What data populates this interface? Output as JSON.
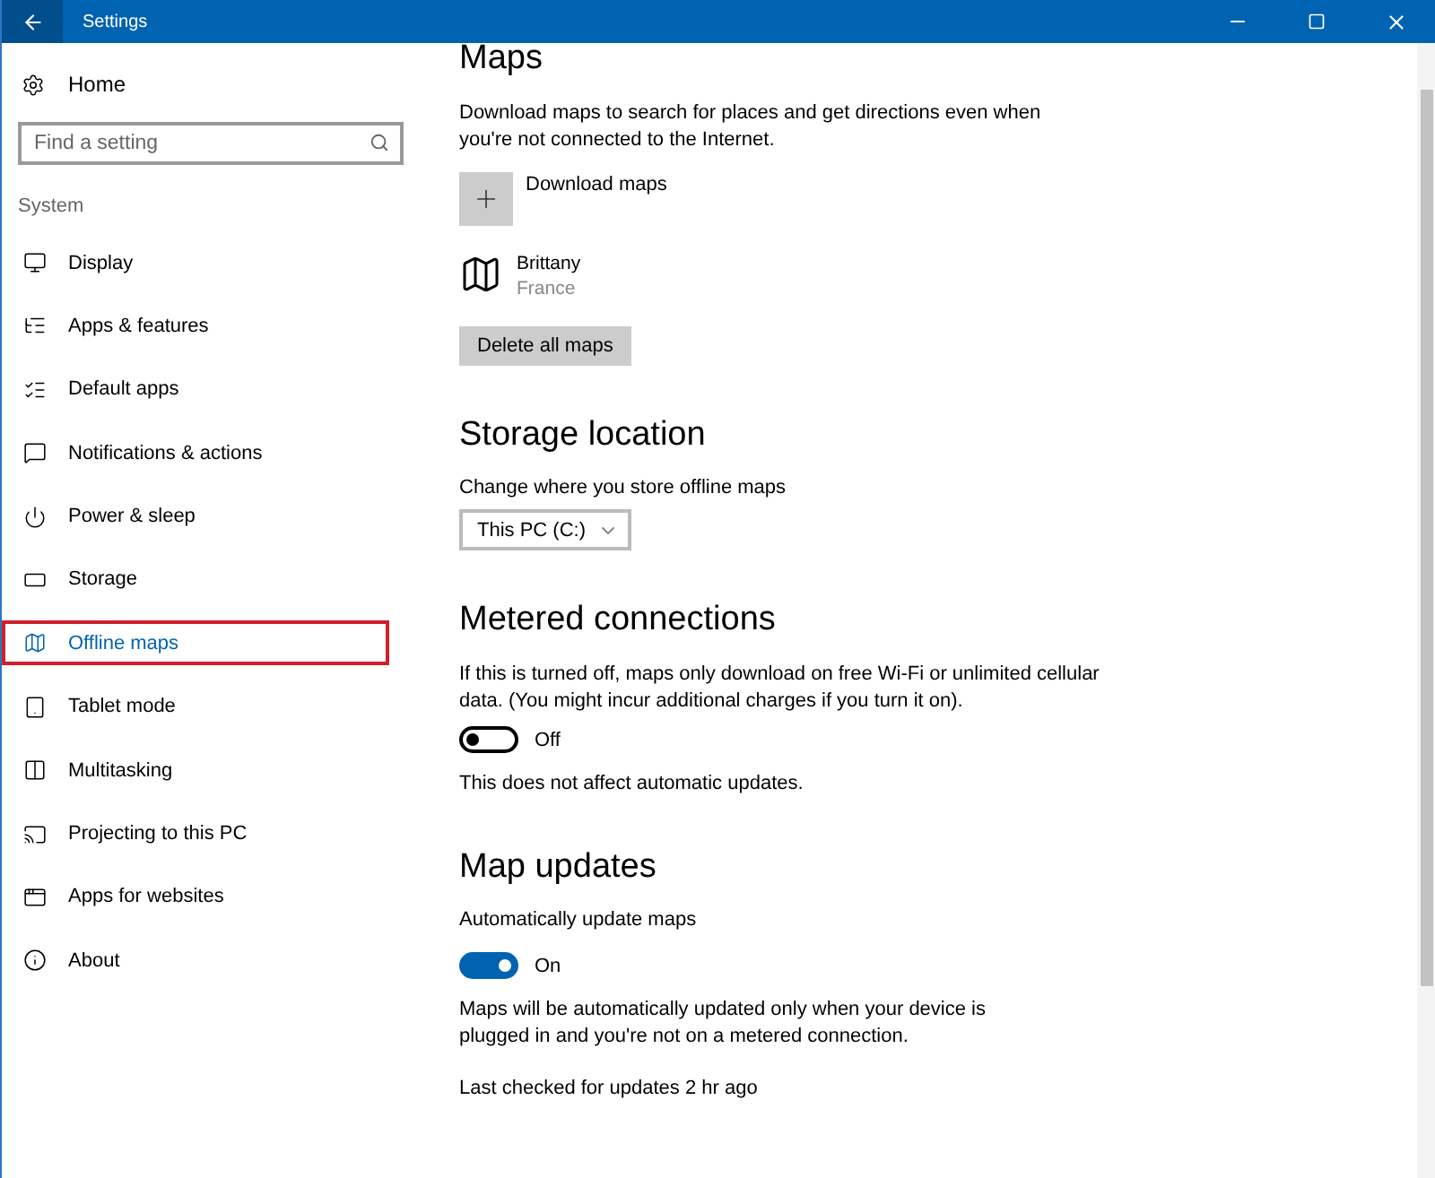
{
  "window": {
    "title": "Settings"
  },
  "sidebar": {
    "home": "Home",
    "search": {
      "placeholder": "Find a setting"
    },
    "group": "System",
    "items": [
      {
        "label": "Display",
        "selected": false
      },
      {
        "label": "Apps & features",
        "selected": false
      },
      {
        "label": "Default apps",
        "selected": false
      },
      {
        "label": "Notifications & actions",
        "selected": false
      },
      {
        "label": "Power & sleep",
        "selected": false
      },
      {
        "label": "Storage",
        "selected": false
      },
      {
        "label": "Offline maps",
        "selected": true
      },
      {
        "label": "Tablet mode",
        "selected": false
      },
      {
        "label": "Multitasking",
        "selected": false
      },
      {
        "label": "Projecting to this PC",
        "selected": false
      },
      {
        "label": "Apps for websites",
        "selected": false
      },
      {
        "label": "About",
        "selected": false
      }
    ]
  },
  "maps": {
    "heading": "Maps",
    "description": "Download maps to search for places and get directions even when you're not connected to the Internet.",
    "download": "Download maps",
    "downloaded": [
      {
        "name": "Brittany",
        "country": "France"
      }
    ],
    "delete": "Delete all maps"
  },
  "storage": {
    "heading": "Storage location",
    "label": "Change where you store offline maps",
    "value": "This PC (C:)"
  },
  "metered": {
    "heading": "Metered connections",
    "description": "If this is turned off, maps only download on free Wi-Fi or unlimited cellular data. (You might incur additional charges if you turn it on).",
    "toggle": {
      "on": false,
      "label": "Off"
    },
    "note": "This does not affect automatic updates."
  },
  "updates": {
    "heading": "Map updates",
    "label": "Automatically update maps",
    "toggle": {
      "on": true,
      "label": "On"
    },
    "note": "Maps will be automatically updated only when your device is plugged in and you're not on a metered connection.",
    "last_checked": "Last checked for updates 2 hr ago"
  }
}
